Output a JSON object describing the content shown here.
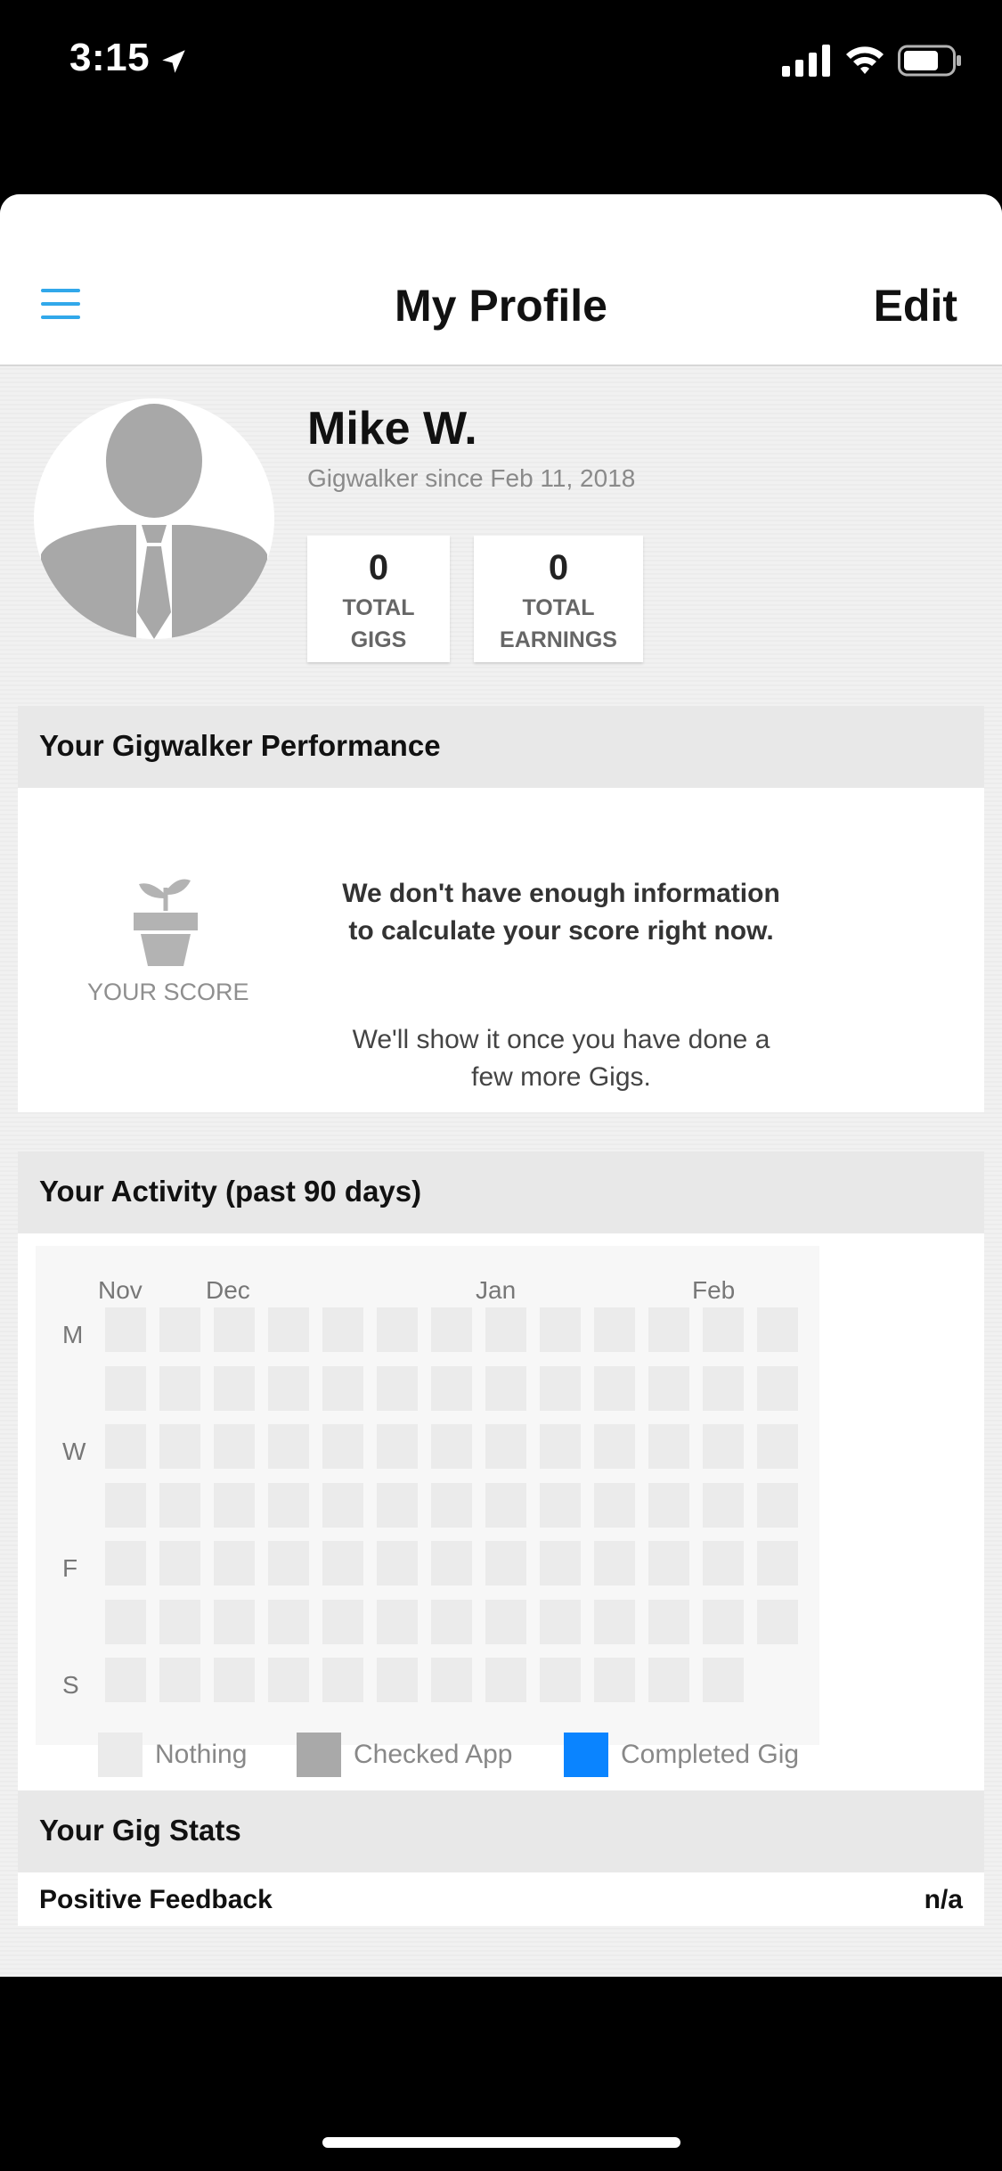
{
  "status_bar": {
    "time": "3:15"
  },
  "nav": {
    "title": "My Profile",
    "edit_label": "Edit"
  },
  "profile": {
    "name": "Mike W.",
    "since": "Gigwalker since Feb 11, 2018",
    "stats": [
      {
        "value": "0",
        "label_line1": "TOTAL",
        "label_line2": "GIGS"
      },
      {
        "value": "0",
        "label_line1": "TOTAL",
        "label_line2": "EARNINGS"
      }
    ]
  },
  "performance": {
    "heading": "Your Gigwalker Performance",
    "score_label": "YOUR SCORE",
    "message_bold": "We don't have enough information to calculate your score right now.",
    "message": "We'll show it once you have done a few more Gigs."
  },
  "activity": {
    "heading": "Your Activity (past 90 days)",
    "months": [
      "Nov",
      "Dec",
      "Jan",
      "Feb"
    ],
    "days": [
      "M",
      "W",
      "F",
      "S"
    ],
    "legend": [
      {
        "label": "Nothing",
        "color": "#ebebeb"
      },
      {
        "label": "Checked App",
        "color": "#a9a9a9"
      },
      {
        "label": "Completed Gig",
        "color": "#0a84ff"
      }
    ]
  },
  "gig_stats": {
    "heading": "Your Gig Stats",
    "rows": [
      {
        "label": "Positive Feedback",
        "value": "n/a"
      }
    ]
  }
}
